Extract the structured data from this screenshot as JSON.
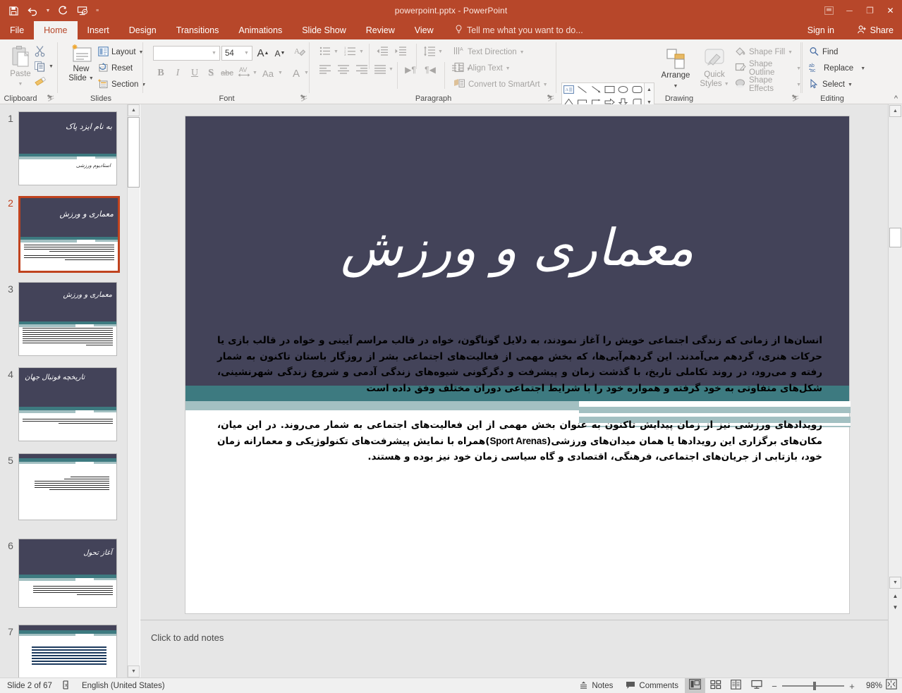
{
  "window": {
    "title": "powerpoint.pptx - PowerPoint",
    "minimize": "─",
    "restore": "❐",
    "close": "✕"
  },
  "quick_access": {
    "save": "save-icon",
    "undo": "undo-icon",
    "redo": "redo-icon",
    "start_slideshow": "slideshow-icon",
    "customize": "≡"
  },
  "tabs": [
    {
      "label": "File",
      "active": false
    },
    {
      "label": "Home",
      "active": true
    },
    {
      "label": "Insert",
      "active": false
    },
    {
      "label": "Design",
      "active": false
    },
    {
      "label": "Transitions",
      "active": false
    },
    {
      "label": "Animations",
      "active": false
    },
    {
      "label": "Slide Show",
      "active": false
    },
    {
      "label": "Review",
      "active": false
    },
    {
      "label": "View",
      "active": false
    }
  ],
  "tellme": {
    "placeholder": "Tell me what you want to do..."
  },
  "account": {
    "signin": "Sign in",
    "share": "Share"
  },
  "ribbon": {
    "clipboard": {
      "label": "Clipboard",
      "paste": "Paste",
      "cut": "cut-icon",
      "copy": "copy-icon",
      "format_painter": "format-painter-icon"
    },
    "slides": {
      "label": "Slides",
      "new_slide": "New\nSlide",
      "new_slide_l1": "New",
      "new_slide_l2": "Slide",
      "layout": "Layout",
      "reset": "Reset",
      "section": "Section"
    },
    "font": {
      "label": "Font",
      "font_name_value": "",
      "font_size_value": "54",
      "grow_font": "A",
      "shrink_font": "A",
      "clear_formatting": "clear-formatting-icon",
      "bold": "B",
      "italic": "I",
      "underline": "U",
      "shadow": "S",
      "strikethrough": "abc",
      "character_spacing": "AV",
      "change_case": "Aa",
      "font_color": "A"
    },
    "paragraph": {
      "label": "Paragraph",
      "bullets": "bullets-icon",
      "numbering": "numbering-icon",
      "decrease_indent": "decrease-indent-icon",
      "increase_indent": "increase-indent-icon",
      "line_spacing": "line-spacing-icon",
      "align_left": "align-left-icon",
      "align_center": "align-center-icon",
      "align_right": "align-right-icon",
      "justify": "justify-icon",
      "ltr": "ltr-icon",
      "rtl": "rtl-icon",
      "columns": "columns-icon",
      "text_direction": "Text Direction",
      "align_text": "Align Text",
      "convert_to_smartart": "Convert to SmartArt"
    },
    "drawing": {
      "label": "Drawing",
      "arrange": "Arrange",
      "quick_styles_l1": "Quick",
      "quick_styles_l2": "Styles",
      "shape_fill": "Shape Fill",
      "shape_outline": "Shape Outline",
      "shape_effects": "Shape Effects"
    },
    "editing": {
      "label": "Editing",
      "find": "Find",
      "replace": "Replace",
      "select": "Select"
    },
    "collapse": "^"
  },
  "slides_panel": {
    "thumbnails": [
      {
        "number": "1",
        "title": "به نام ایزد پاک",
        "selected": false,
        "lines": 0,
        "has_subtitle": true,
        "subtitle": "استادیوم ورزشی",
        "layout": "title"
      },
      {
        "number": "2",
        "title": "معماری و ورزش",
        "selected": true,
        "lines": 9,
        "has_subtitle": false,
        "layout": "title-body"
      },
      {
        "number": "3",
        "title": "معماری و ورزش",
        "selected": false,
        "lines": 11,
        "has_subtitle": false,
        "layout": "title-body"
      },
      {
        "number": "4",
        "title": "تاریخچه فوتبال جهان",
        "selected": false,
        "lines": 3,
        "has_subtitle": false,
        "layout": "title-body"
      },
      {
        "number": "5",
        "title": "",
        "selected": false,
        "lines": 8,
        "has_subtitle": false,
        "layout": "body-only"
      },
      {
        "number": "6",
        "title": "آغاز تحول",
        "selected": false,
        "lines": 6,
        "has_subtitle": false,
        "layout": "title-body"
      },
      {
        "number": "7",
        "title": "",
        "selected": false,
        "lines": 10,
        "has_subtitle": false,
        "layout": "body-only"
      }
    ]
  },
  "slide": {
    "title": "معماری و ورزش",
    "paragraph1": "انسان‌ها از زمانی که زندگی اجتماعی خویش را آغاز نمودند، به دلایل گوناگون، خواه در قالب مراسم آیینی و خواه در قالب بازی یا حرکات هنری، گردهم می‌آمدند. این گردهم‌آیی‌ها، که بخش مهمی از فعالیت‌های اجتماعی بشر از روزگار باستان تاکنون به شمار رفته و می‌رود، در روند تکاملی تاریخ، با گذشت زمان و پیشرفت و دگرگونی شیوه‌های زندگی آدمی و شروع زندگی شهرنشینی، شکل‌های متفاوتی به خود گرفته و همواره خود را با شرایط اجتماعی دوران مختلف وفق داده است",
    "paragraph2_part1": "رویدادهای ورزشی نیز از زمان پیدایش تاکنون به عنوان بخش مهمی از این فعالیت‌های اجتماعی به شمار می‌روند. در این میان، مکان‌های برگزاری این رویدادها یا همان میدان‌های ورزشی(",
    "paragraph2_english": "Sport Arenas",
    "paragraph2_part2": ")همراه با نمایش پیشرفت‌های تکنولوژیکی و معمارانه زمان خود، بازتابی از جریان‌های اجتماعی، فرهنگی، اقتصادی و گاه سیاسی زمان خود نیز بوده و هستند."
  },
  "notes": {
    "placeholder": "Click to add notes"
  },
  "status": {
    "slide_counter": "Slide 2 of 67",
    "spelling": "spell-check-icon",
    "language": "English (United States)",
    "notes": "Notes",
    "comments": "Comments",
    "view_normal": "normal-view-icon",
    "view_sorter": "slide-sorter-icon",
    "view_reading": "reading-view-icon",
    "view_slideshow": "slideshow-view-icon",
    "zoom_out": "−",
    "zoom_in": "+",
    "zoom_level": "98%",
    "fit_to_window": "fit-slide-icon"
  },
  "colors": {
    "brand": "#b7472a",
    "slide_header": "#434359",
    "teal": "#3d7a80",
    "light_teal": "#a3c0c2",
    "selection": "#c0431f"
  }
}
